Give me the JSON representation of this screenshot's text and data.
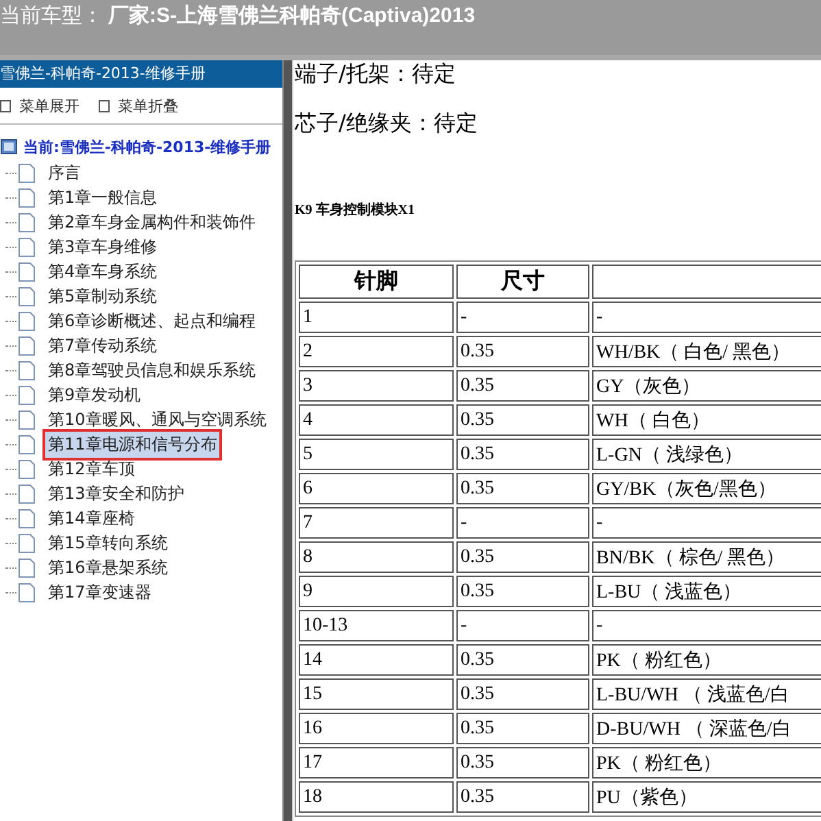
{
  "title_bar": {
    "label": "当前车型：",
    "value": "厂家:S-上海雪佛兰科帕奇(Captiva)2013"
  },
  "sidebar": {
    "title": "雪佛兰-科帕奇-2013-维修手册",
    "toolbar": [
      "菜单展开",
      "菜单折叠"
    ],
    "root": "当前:雪佛兰-科帕奇-2013-维修手册",
    "items": [
      {
        "label": "序言",
        "selected": false
      },
      {
        "label": "第1章一般信息",
        "selected": false
      },
      {
        "label": "第2章车身金属构件和装饰件",
        "selected": false
      },
      {
        "label": "第3章车身维修",
        "selected": false
      },
      {
        "label": "第4章车身系统",
        "selected": false
      },
      {
        "label": "第5章制动系统",
        "selected": false
      },
      {
        "label": "第6章诊断概述、起点和编程",
        "selected": false
      },
      {
        "label": "第7章传动系统",
        "selected": false
      },
      {
        "label": "第8章驾驶员信息和娱乐系统",
        "selected": false
      },
      {
        "label": "第9章发动机",
        "selected": false
      },
      {
        "label": "第10章暖风、通风与空调系统",
        "selected": false
      },
      {
        "label": "第11章电源和信号分布",
        "selected": true
      },
      {
        "label": "第12章车顶",
        "selected": false
      },
      {
        "label": "第13章安全和防护",
        "selected": false
      },
      {
        "label": "第14章座椅",
        "selected": false
      },
      {
        "label": "第15章转向系统",
        "selected": false
      },
      {
        "label": "第16章悬架系统",
        "selected": false
      },
      {
        "label": "第17章变速器",
        "selected": false
      }
    ]
  },
  "content": {
    "lines": [
      "端子/托架：待定",
      "芯子/绝缘夹：待定"
    ],
    "heading": "K9 车身控制模块X1",
    "table": {
      "columns": [
        "针脚",
        "尺寸"
      ],
      "rows": [
        [
          "1",
          "-",
          "-"
        ],
        [
          "2",
          "0.35",
          "WH/BK（ 白色/ 黑色）"
        ],
        [
          "3",
          "0.35",
          "GY（灰色）"
        ],
        [
          "4",
          "0.35",
          "WH（ 白色）"
        ],
        [
          "5",
          "0.35",
          "L-GN（ 浅绿色）"
        ],
        [
          "6",
          "0.35",
          "GY/BK（灰色/黑色）"
        ],
        [
          "7",
          "-",
          "-"
        ],
        [
          "8",
          "0.35",
          "BN/BK（ 棕色/ 黑色）"
        ],
        [
          "9",
          "0.35",
          "L-BU（ 浅蓝色）"
        ],
        [
          "10-13",
          "-",
          "-"
        ],
        [
          "14",
          "0.35",
          "PK（ 粉红色）"
        ],
        [
          "15",
          "0.35",
          "L-BU/WH （ 浅蓝色/白"
        ],
        [
          "16",
          "0.35",
          "D-BU/WH （ 深蓝色/白"
        ],
        [
          "17",
          "0.35",
          "PK（ 粉红色）"
        ],
        [
          "18",
          "0.35",
          "PU（紫色）"
        ]
      ]
    }
  }
}
